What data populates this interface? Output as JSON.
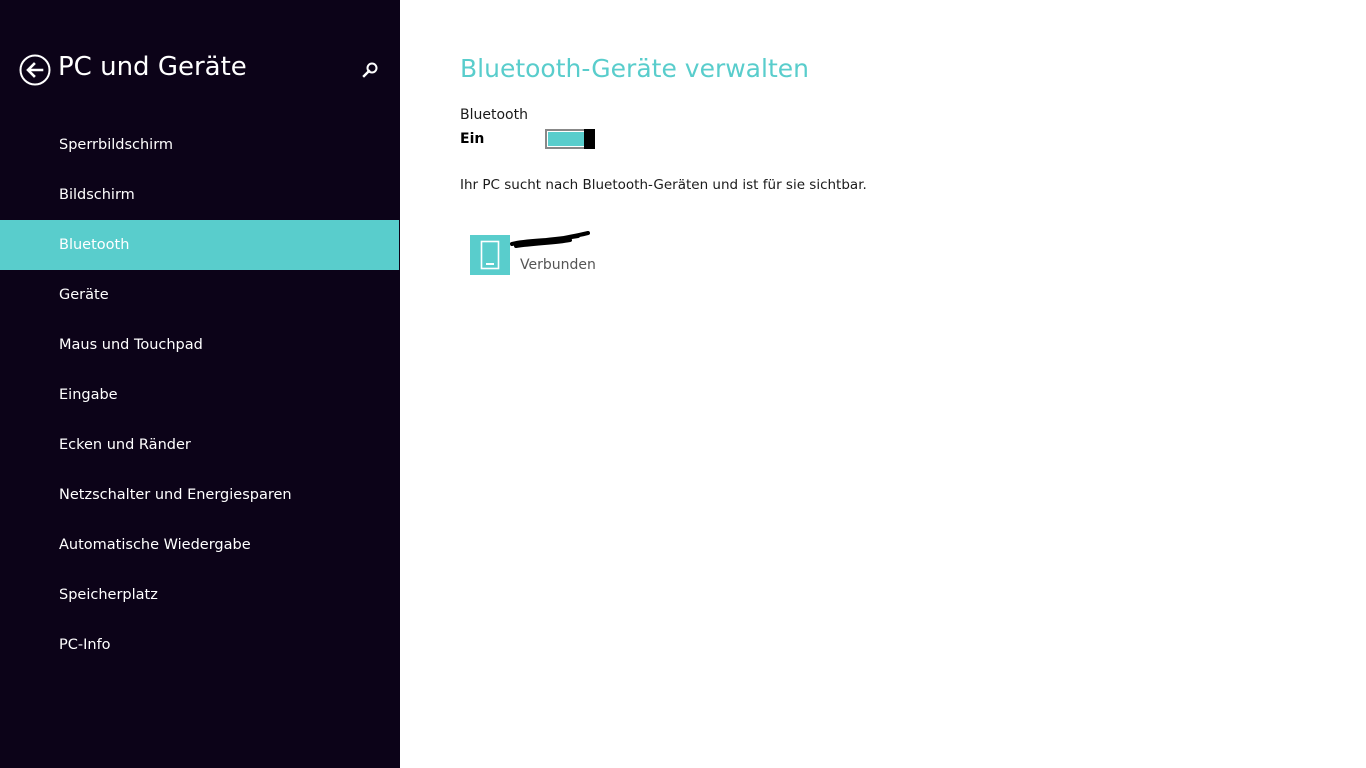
{
  "sidebar": {
    "title": "PC und Geräte",
    "back_icon": "back-arrow-circle-icon",
    "search_icon": "search-icon",
    "items": [
      {
        "label": "Sperrbildschirm",
        "active": false
      },
      {
        "label": "Bildschirm",
        "active": false
      },
      {
        "label": "Bluetooth",
        "active": true
      },
      {
        "label": "Geräte",
        "active": false
      },
      {
        "label": "Maus und Touchpad",
        "active": false
      },
      {
        "label": "Eingabe",
        "active": false
      },
      {
        "label": "Ecken und Ränder",
        "active": false
      },
      {
        "label": "Netzschalter und Energiesparen",
        "active": false
      },
      {
        "label": "Automatische Wiedergabe",
        "active": false
      },
      {
        "label": "Speicherplatz",
        "active": false
      },
      {
        "label": "PC-Info",
        "active": false
      }
    ]
  },
  "main": {
    "title": "Bluetooth-Geräte verwalten",
    "bluetooth_label": "Bluetooth",
    "bluetooth_state": "Ein",
    "bluetooth_on": true,
    "status_text": "Ihr PC sucht nach Bluetooth-Geräten und ist für sie sichtbar.",
    "devices": [
      {
        "name": "",
        "status": "Verbunden",
        "icon": "phone-icon"
      }
    ]
  },
  "colors": {
    "accent": "#59cdcc",
    "sidebar_bg": "#0c0318",
    "main_bg": "#ffffff"
  }
}
